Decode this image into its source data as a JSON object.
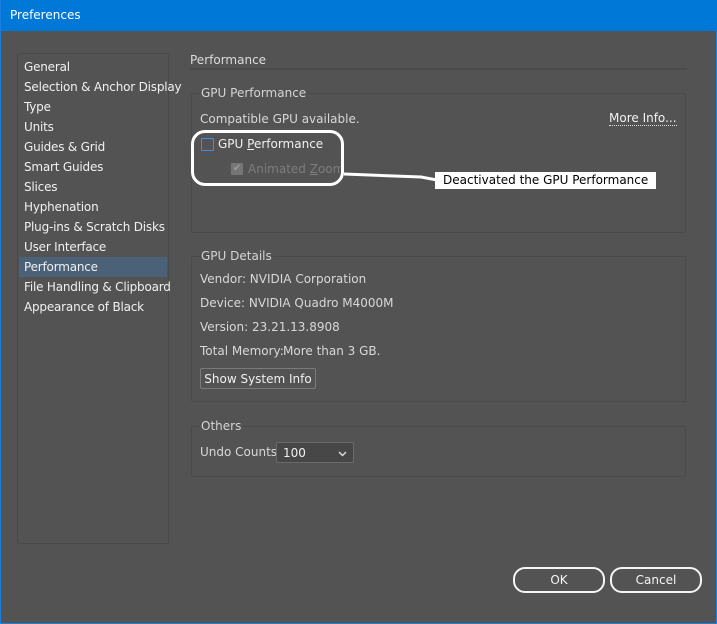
{
  "window": {
    "title": "Preferences"
  },
  "sidebar": {
    "items": [
      {
        "label": "General",
        "selected": false
      },
      {
        "label": "Selection & Anchor Display",
        "selected": false
      },
      {
        "label": "Type",
        "selected": false
      },
      {
        "label": "Units",
        "selected": false
      },
      {
        "label": "Guides & Grid",
        "selected": false
      },
      {
        "label": "Smart Guides",
        "selected": false
      },
      {
        "label": "Slices",
        "selected": false
      },
      {
        "label": "Hyphenation",
        "selected": false
      },
      {
        "label": "Plug-ins & Scratch Disks",
        "selected": false
      },
      {
        "label": "User Interface",
        "selected": false
      },
      {
        "label": "Performance",
        "selected": true
      },
      {
        "label": "File Handling & Clipboard",
        "selected": false
      },
      {
        "label": "Appearance of Black",
        "selected": false
      }
    ]
  },
  "main": {
    "title": "Performance",
    "gpu_performance": {
      "group_label": "GPU Performance",
      "status": "Compatible GPU available.",
      "more_info_link": "More Info...",
      "gpu_checkbox": {
        "label_pre": "GPU ",
        "label_mnemonic": "P",
        "label_post": "erformance",
        "checked": false
      },
      "animated_zoom_checkbox": {
        "label_pre": "Animated ",
        "label_mnemonic": "Z",
        "label_post": "oom",
        "checked": true,
        "disabled": true
      }
    },
    "gpu_details": {
      "group_label": "GPU Details",
      "vendor": "Vendor: NVIDIA Corporation",
      "device": "Device: NVIDIA Quadro M4000M",
      "version": "Version: 23.21.13.8908",
      "memory_label": "Total Memory:",
      "memory_value": "More than 3 GB.",
      "show_system_info_button": "Show System Info"
    },
    "others": {
      "group_label": "Others",
      "undo_counts_label": "Undo Counts:",
      "undo_counts_value": "100"
    }
  },
  "footer": {
    "ok_label": "OK",
    "cancel_label": "Cancel"
  },
  "annotation": {
    "text": "Deactivated the GPU Performance"
  },
  "icons": {
    "checkmark": "✔",
    "chevron_down": "⌄"
  }
}
